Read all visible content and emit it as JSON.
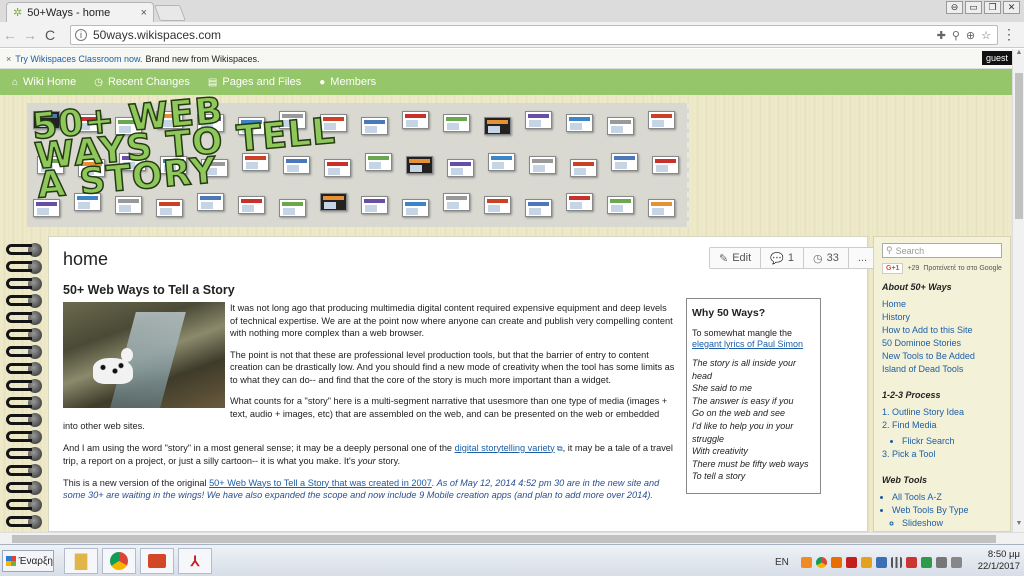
{
  "browser": {
    "tab_title": "50+Ways - home",
    "tab_close": "×",
    "url": "50ways.wikispaces.com",
    "back": "←",
    "forward": "→",
    "reload": "C",
    "info": "i",
    "star": "☆",
    "menu": "⋮",
    "window_controls": [
      "⊖",
      "▭",
      "❐",
      "✕"
    ]
  },
  "notice": {
    "close": "×",
    "link": "Try Wikispaces Classroom now.",
    "text": "Brand new from Wikispaces.",
    "guest": "guest"
  },
  "wiki_nav": {
    "items": [
      {
        "icon": "⌂",
        "label": "Wiki Home"
      },
      {
        "icon": "◷",
        "label": "Recent Changes"
      },
      {
        "icon": "▤",
        "label": "Pages and Files"
      },
      {
        "icon": "●",
        "label": "Members"
      }
    ]
  },
  "banner": {
    "logo_line1": "50+ WEB",
    "logo_line2": "WAYS TO TELL",
    "logo_line3": "A STORY"
  },
  "page": {
    "title": "home",
    "actions": {
      "edit": "Edit",
      "comments": "1",
      "history": "33",
      "more": "..."
    },
    "heading": "50+ Web Ways to Tell a Story",
    "p1": "It was not long ago that producing multimedia digital content required expensive equipment and deep levels of technical expertise. We are at the point now where anyone can create and publish very compelling content with nothing more complex than a web browser.",
    "p2": "The point is not that these are professional level production tools, but that the barrier of entry to content creation can be drastically low. And you should find a new mode of creativity when the tool has some limits as to what they can do-- and find that the core of the story is much more important than a widget.",
    "p3": "What counts for a \"story\" here is a multi-segment narrative that usesmore than one type of media (images + text, audio + images, etc) that are assembled on the web, and can be presented on the web or embedded into other web sites.",
    "p4_a": "And I am using the word \"story\" in a most general sense; it may be a deeply personal one of the",
    "p4_link": "digital storytelling variety",
    "p4_b": ", it may be a tale of a travel trip, a report on a project, or just a silly cartoon-- it is what you make. It's",
    "p4_ital": "your",
    "p4_c": "story.",
    "p5_a": "This is a new version of the original",
    "p5_link": "50+ Web Ways to Tell a Story that was created in 2007",
    "p5_b": ". As of May 12, 2014 4:52 pm 30 are in the new site and some 30+ are waiting in the wings! We have also expanded the scope and now include 9 Mobile creation apps (and plan to add more over 2014)."
  },
  "why_box": {
    "title": "Why 50 Ways?",
    "intro": "To somewhat mangle the",
    "link": "elegant lyrics of Paul Simon",
    "lines": [
      "The story is all inside your",
      "head",
      "She said to me",
      "The answer is easy if you",
      "Go on the web and see",
      "I'd like to help you in your",
      "struggle",
      "With creativity",
      "There must be fifty web ways",
      "To tell a story"
    ]
  },
  "sidebar": {
    "search_placeholder": "Search",
    "gplus_label": "G+1",
    "gplus_count": "+29",
    "gplus_text": "Προτείνετέ το στο Google",
    "about_heading": "About 50+ Ways",
    "about_items": [
      "Home",
      "History",
      "How to Add to this Site",
      "50 Dominoe Stories",
      "New Tools to Be Added",
      "Island of Dead Tools"
    ],
    "process_heading": "1-2-3 Process",
    "process_items": [
      "Outline Story Idea",
      "Find Media",
      "Flickr Search",
      "Pick a Tool"
    ],
    "tools_heading": "Web Tools",
    "tools_items": [
      "All Tools A-Z",
      "Web Tools By Type",
      "Slideshow"
    ]
  },
  "taskbar": {
    "start_label": "Έναρξη",
    "lang": "EN",
    "time": "8:50 μμ",
    "date": "22/1/2017"
  }
}
